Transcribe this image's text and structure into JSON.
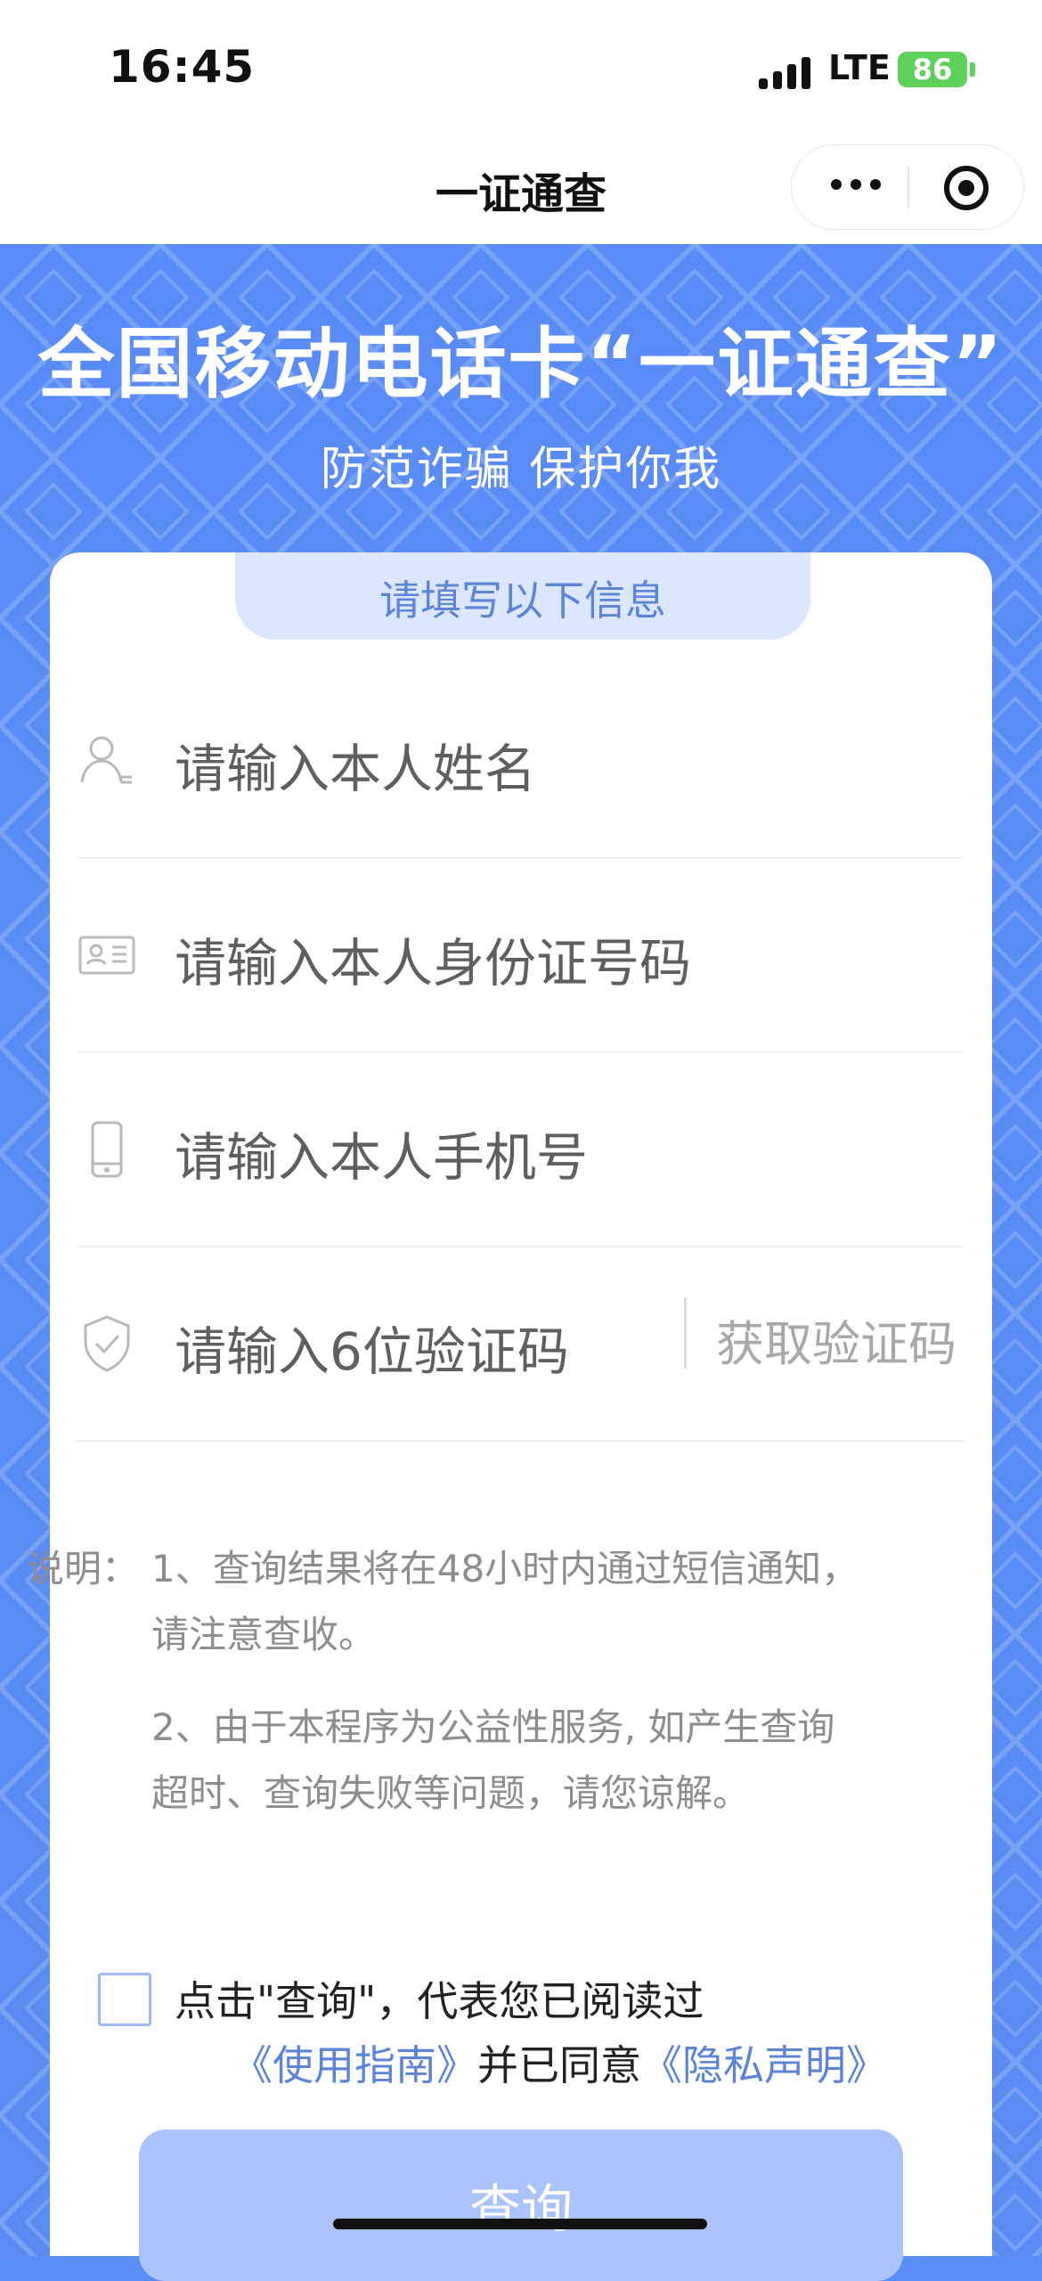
{
  "status_bar": {
    "time": "16:45",
    "network": "LTE",
    "battery": "86"
  },
  "nav": {
    "title": "一证通查"
  },
  "hero": {
    "title": "全国移动电话卡“一证通查”",
    "subtitle": "防范诈骗 保护你我"
  },
  "form": {
    "tab": "请填写以下信息",
    "name_placeholder": "请输入本人姓名",
    "id_placeholder": "请输入本人身份证号码",
    "phone_placeholder": "请输入本人手机号",
    "code_placeholder": "请输入6位验证码",
    "code_button": "获取验证码"
  },
  "description": {
    "label": "说明：",
    "item1": "1、查询结果将在48小时内通过短信通知，请注意查收。",
    "item2": "2、由于本程序为公益性服务, 如产生查询超时、查询失败等问题，请您谅解。"
  },
  "agreement": {
    "prefix": "点击\"查询\"，代表您已阅读过",
    "guide": "《使用指南》",
    "middle": "并已同意",
    "privacy": "《隐私声明》"
  },
  "button": {
    "query": "查询"
  }
}
